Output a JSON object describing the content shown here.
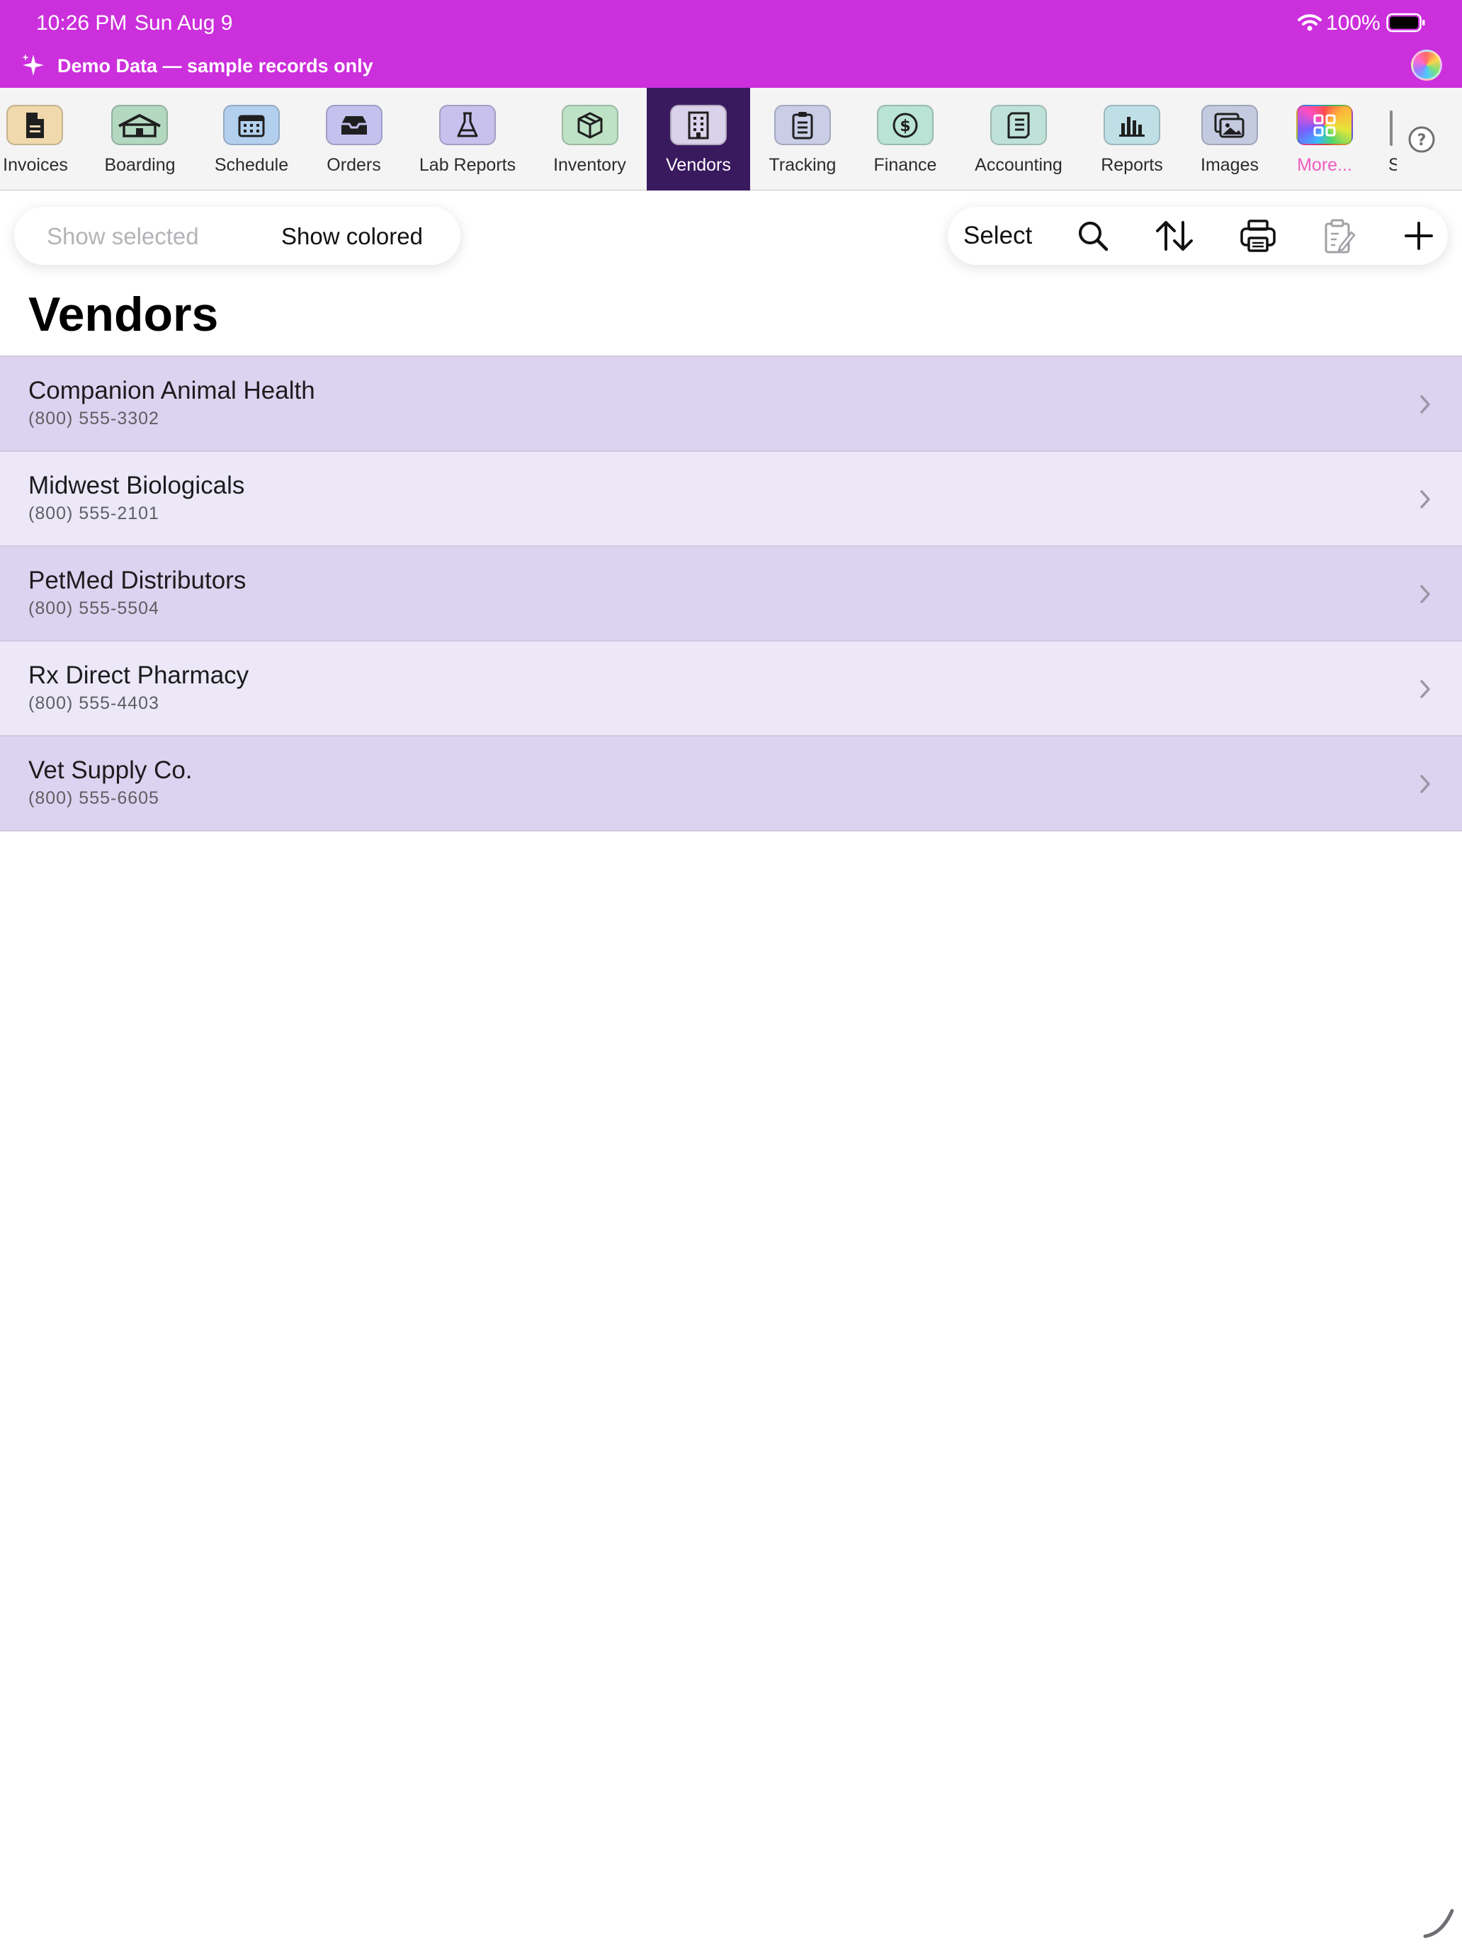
{
  "status_bar": {
    "time": "10:26 PM",
    "date": "Sun Aug 9",
    "battery": "100%",
    "wifi_icon": "wifi-icon",
    "battery_icon": "battery-icon"
  },
  "banner": {
    "icon": "sparkle-icon",
    "text": "Demo Data — sample records only",
    "background": "#cc2fdc"
  },
  "tabs": [
    {
      "label": "Invoices",
      "icon": "document-icon",
      "color": "#f0d9ad"
    },
    {
      "label": "Boarding",
      "icon": "house-icon",
      "color": "#b3d8c0"
    },
    {
      "label": "Schedule",
      "icon": "calendar-icon",
      "color": "#b2d0ee"
    },
    {
      "label": "Orders",
      "icon": "inbox-icon",
      "color": "#c4c1ee"
    },
    {
      "label": "Lab Reports",
      "icon": "flask-icon",
      "color": "#c8c1ee"
    },
    {
      "label": "Inventory",
      "icon": "box-icon",
      "color": "#bde2c5"
    },
    {
      "label": "Vendors",
      "icon": "building-icon",
      "color": "#d9d2ea",
      "active": true
    },
    {
      "label": "Tracking",
      "icon": "clipboard-icon",
      "color": "#c9cde6"
    },
    {
      "label": "Finance",
      "icon": "dollar-icon",
      "color": "#b9e3d5"
    },
    {
      "label": "Accounting",
      "icon": "ledger-icon",
      "color": "#bfe2d8"
    },
    {
      "label": "Reports",
      "icon": "bar-chart-icon",
      "color": "#bfdfe6"
    },
    {
      "label": "Images",
      "icon": "photos-icon",
      "color": "#c4cbe0"
    },
    {
      "label": "More...",
      "icon": "grid-icon",
      "color": "rainbow"
    }
  ],
  "tab_partial_label": "S",
  "toolbar": {
    "show_selected": "Show selected",
    "show_colored": "Show colored",
    "select_label": "Select",
    "icons": [
      "search-icon",
      "sort-icon",
      "print-icon",
      "edit-clipboard-icon",
      "add-icon"
    ]
  },
  "page": {
    "title": "Vendors"
  },
  "vendors": [
    {
      "name": "Companion Animal Health",
      "phone": "(800) 555-3302"
    },
    {
      "name": "Midwest Biologicals",
      "phone": "(800) 555-2101"
    },
    {
      "name": "PetMed Distributors",
      "phone": "(800) 555-5504"
    },
    {
      "name": "Rx Direct Pharmacy",
      "phone": "(800) 555-4403"
    },
    {
      "name": "Vet Supply Co.",
      "phone": "(800) 555-6605"
    }
  ],
  "colors": {
    "accent_active_tab": "#3a1a5e",
    "row_tone_a": "#dcd3f0",
    "row_tone_b": "#ece8f8"
  }
}
